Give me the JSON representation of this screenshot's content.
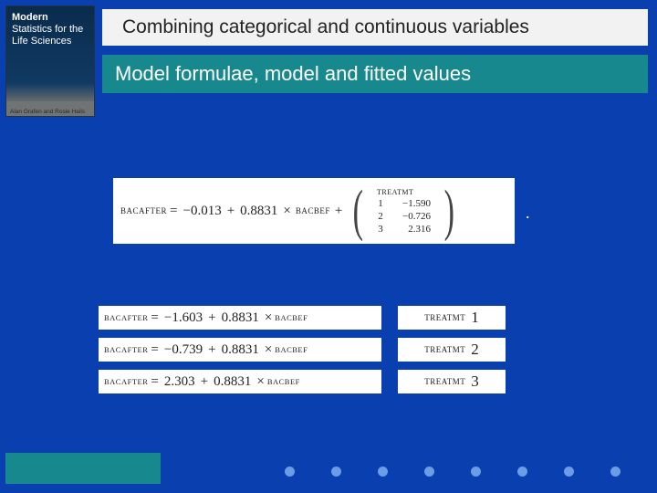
{
  "cover": {
    "l1": "Modern",
    "l2": "Statistics for the",
    "l3": "Life Sciences",
    "authors": "Alan Grafen and Rosie Hails"
  },
  "title": "Combining categorical and continuous variables",
  "subtitle": "Model formulae, model and fitted values",
  "main_equation": {
    "lhs": "BACAFTER",
    "eq": "=",
    "c0": "−0.013",
    "plus1": "+",
    "c1": "0.8831",
    "times1": "×",
    "v1": "BACBEF",
    "plus2": "+",
    "treat_header": "TREATMT",
    "rows": [
      {
        "idx": "1",
        "val": "−1.590"
      },
      {
        "idx": "2",
        "val": "−0.726"
      },
      {
        "idx": "3",
        "val": "2.316"
      }
    ],
    "dot": "."
  },
  "fitted": [
    {
      "lhs": "BACAFTER",
      "eq": "=",
      "a": "−1.603",
      "plus": "+",
      "b": "0.8831",
      "times": "×",
      "v": "BACBEF",
      "label": "TREATMT",
      "n": "1"
    },
    {
      "lhs": "BACAFTER",
      "eq": "=",
      "a": "−0.739",
      "plus": "+",
      "b": "0.8831",
      "times": "×",
      "v": "BACBEF",
      "label": "TREATMT",
      "n": "2"
    },
    {
      "lhs": "BACAFTER",
      "eq": "=",
      "a": "2.303",
      "plus": "+",
      "b": "0.8831",
      "times": "×",
      "v": "BACBEF",
      "label": "TREATMT",
      "n": "3"
    }
  ]
}
